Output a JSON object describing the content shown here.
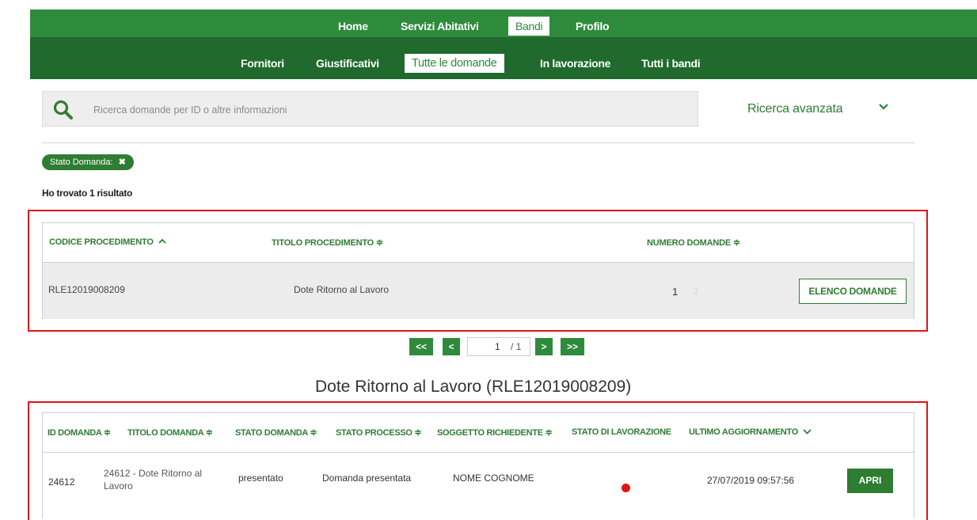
{
  "nav_primary": {
    "items": [
      {
        "label": "Home",
        "active": false
      },
      {
        "label": "Servizi Abitativi",
        "active": false
      },
      {
        "label": "Bandi",
        "active": true
      },
      {
        "label": "Profilo",
        "active": false
      }
    ]
  },
  "nav_secondary": {
    "items": [
      {
        "label": "Fornitori",
        "active": false
      },
      {
        "label": "Giustificativi",
        "active": false
      },
      {
        "label": "Tutte le domande",
        "active": true
      },
      {
        "label": "In lavorazione",
        "active": false
      },
      {
        "label": "Tutti i bandi",
        "active": false
      }
    ]
  },
  "search": {
    "placeholder": "Ricerca domande per ID o altre informazioni",
    "value": "",
    "advanced_label": "Ricerca avanzata"
  },
  "filters": {
    "chip_label": "Stato Domanda:",
    "chip_remove": "✖"
  },
  "results_text": "Ho trovato 1 risultato",
  "procedures_table": {
    "headers": {
      "codice": "CODICE PROCEDIMENTO",
      "codice_sort": "⌃",
      "titolo": "TITOLO PROCEDIMENTO ≑",
      "numero": "NUMERO DOMANDE ≑"
    },
    "rows": [
      {
        "codice": "RLE12019008209",
        "titolo": "Dote Ritorno al Lavoro",
        "numero": "1",
        "numero_faded": "3",
        "action": "ELENCO DOMANDE"
      }
    ]
  },
  "pagination": {
    "first": "<<",
    "prev": "<",
    "page": "1",
    "total": "/ 1",
    "next": ">",
    "last": ">>"
  },
  "section_title": "Dote Ritorno al Lavoro (RLE12019008209)",
  "applications_table": {
    "headers": {
      "id": "ID DOMANDA ≑",
      "titolo": "TITOLO DOMANDA ≑",
      "stato": "STATO DOMANDA ≑",
      "processo": "STATO PROCESSO ≑",
      "soggetto": "SOGGETTO RICHIEDENTE ≑",
      "lavorazione": "STATO DI LAVORAZIONE",
      "aggiornamento": "ULTIMO AGGIORNAMENTO"
    },
    "rows": [
      {
        "id": "24612",
        "titolo_line1": "24612 - Dote Ritorno al",
        "titolo_line2": "Lavoro",
        "stato": "presentato",
        "processo": "Domanda presentata",
        "soggetto": "NOME COGNOME",
        "lavorazione_status_color": "#e01414",
        "aggiornamento": "27/07/2019 09:57:56",
        "action": "APRI"
      }
    ]
  },
  "colors": {
    "nav_primary_bg": "#2e8b3c",
    "nav_secondary_bg": "#1f6a2c",
    "accent_green": "#2e7d32",
    "highlight_red": "#e01414"
  }
}
